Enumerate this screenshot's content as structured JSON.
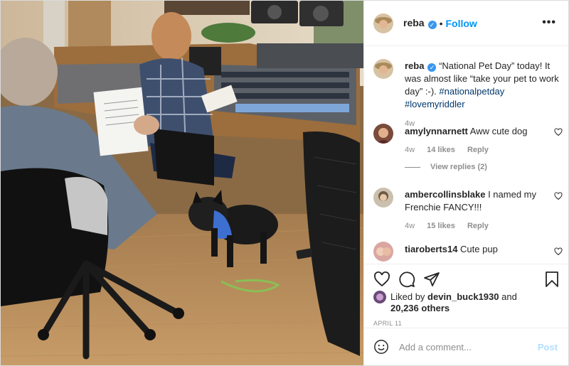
{
  "post": {
    "username": "reba",
    "follow_label": "Follow",
    "more_icon": "ellipsis-icon"
  },
  "caption": {
    "username": "reba",
    "text": "“National Pet Day” today! It was almost like “take your pet to work day” :-). ",
    "tags": [
      "#nationalpetday",
      "#lovemyriddler"
    ],
    "age": "4w"
  },
  "comments": [
    {
      "username": "amylynnarnett",
      "text": "Aww cute dog",
      "age": "4w",
      "likes": "14 likes",
      "reply_label": "Reply"
    },
    {
      "username": "ambercollinsblake",
      "text": "I named my Frenchie FANCY!!!",
      "age": "4w",
      "likes": "15 likes",
      "reply_label": "Reply"
    },
    {
      "username": "tiaroberts14",
      "text": "Cute pup"
    }
  ],
  "view_replies": "View replies (2)",
  "liked_by": {
    "prefix": "Liked by",
    "user": "devin_buck1930",
    "joiner": "and",
    "others": "20,236 others"
  },
  "date": "APRIL 11",
  "add_comment": {
    "placeholder": "Add a comment...",
    "post_label": "Post"
  },
  "colors": {
    "link": "#0095f6",
    "hashtag": "#00376b",
    "verified": "#3897f0",
    "muted": "#8e8e8e",
    "post_disabled": "#b2dffc"
  }
}
